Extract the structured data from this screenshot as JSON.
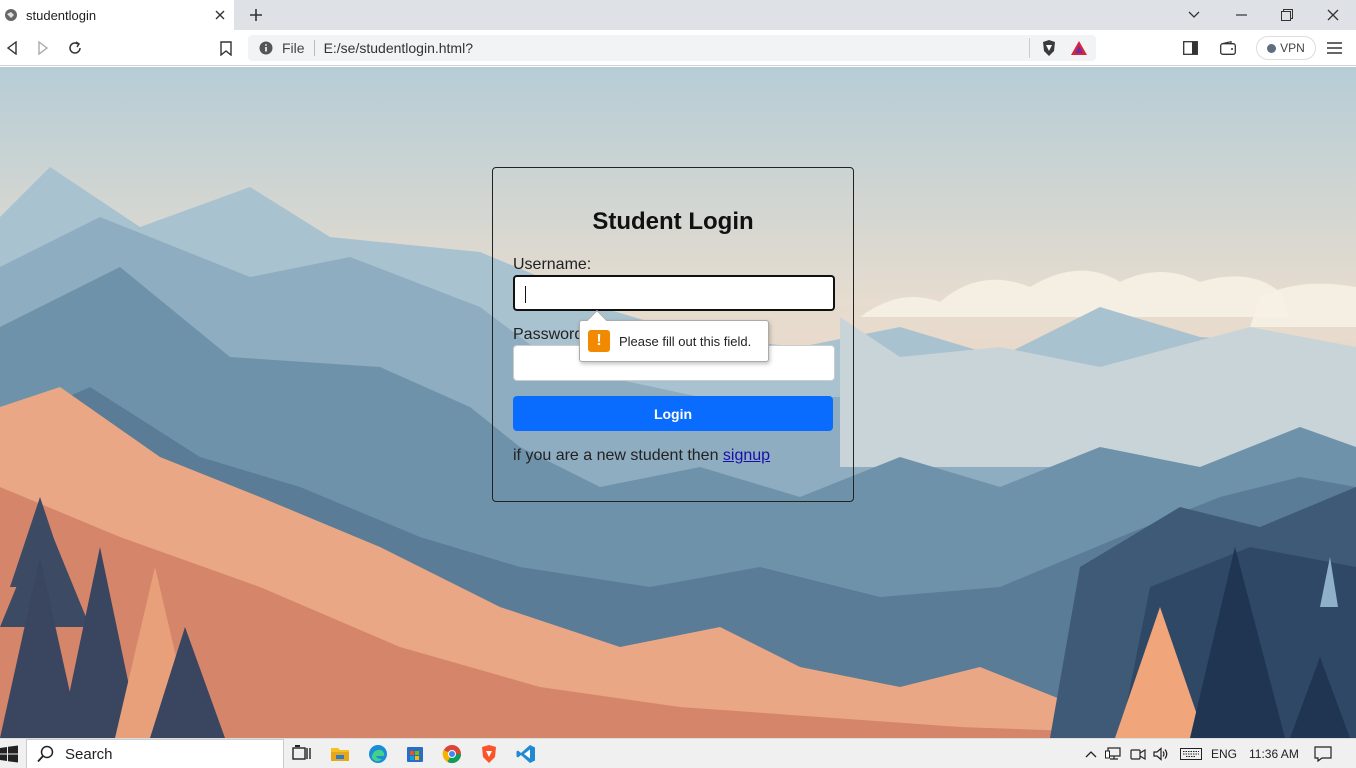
{
  "browser": {
    "tab_title": "studentlogin",
    "address": {
      "scheme_label": "File",
      "url": "E:/se/studentlogin.html?"
    },
    "vpn_label": "VPN"
  },
  "login": {
    "heading": "Student Login",
    "username_label": "Username:",
    "password_label": "Password:",
    "login_button": "Login",
    "signup_prefix": "if you are a new student then ",
    "signup_link": "signup",
    "validation_message": "Please fill out this field."
  },
  "taskbar": {
    "search_placeholder": "Search",
    "language": "ENG",
    "time": "11:36 AM"
  },
  "colors": {
    "accent": "#0a6cff",
    "warning": "#f18a00"
  }
}
